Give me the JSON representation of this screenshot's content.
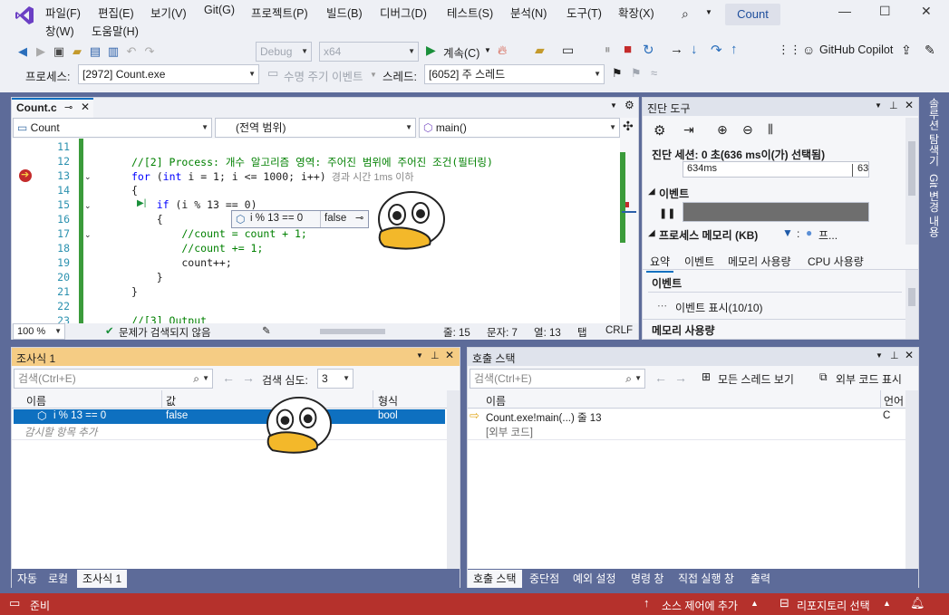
{
  "menu": {
    "items": [
      "파일(F)",
      "편집(E)",
      "보기(V)",
      "Git(G)",
      "프로젝트(P)",
      "빌드(B)",
      "디버그(D)",
      "테스트(S)",
      "분석(N)",
      "도구(T)",
      "확장(X)",
      "창(W)",
      "도움말(H)"
    ],
    "title": "Count"
  },
  "toolbar": {
    "config": "Debug",
    "platform": "x64",
    "run_label": "계속(C)",
    "copilot": "GitHub Copilot"
  },
  "debugbar": {
    "process_label": "프로세스:",
    "process_value": "[2972] Count.exe",
    "lifecycle": "수명 주기 이벤트",
    "thread_label": "스레드:",
    "thread_value": "[6052] 주 스레드"
  },
  "editor": {
    "tab": "Count.c",
    "nav_project": "Count",
    "nav_scope": "(전역 범위)",
    "nav_func": "main()",
    "lines": [
      {
        "n": "11",
        "t": ""
      },
      {
        "n": "12",
        "t": "//[2] Process: 개수 알고리즘 영역: 주어진 범위에 주어진 조건(필터링)"
      },
      {
        "n": "13",
        "t": "for (int i = 1; i <= 1000; i++)"
      },
      {
        "n": "14",
        "t": "{"
      },
      {
        "n": "15",
        "t": "    if (i % 13 == 0)"
      },
      {
        "n": "16",
        "t": "    {"
      },
      {
        "n": "17",
        "t": "        //count = count + 1;"
      },
      {
        "n": "18",
        "t": "        //count += 1;"
      },
      {
        "n": "19",
        "t": "        count++;"
      },
      {
        "n": "20",
        "t": "    }"
      },
      {
        "n": "21",
        "t": "}"
      },
      {
        "n": "22",
        "t": ""
      },
      {
        "n": "23",
        "t": "//[3] Output"
      }
    ],
    "elapsed": "경과 시간 1ms 이하",
    "datatip_expr": "i % 13 == 0",
    "datatip_val": "false",
    "zoom": "100 %",
    "issues": "문제가 검색되지 않음",
    "pos_line": "줄: 15",
    "pos_char": "문자: 7",
    "pos_col": "열: 13",
    "tab_mode": "탭",
    "eol": "CRLF"
  },
  "diag": {
    "title": "진단 도구",
    "session": "진단 세션: 0 초(636 ms이(가) 선택됨)",
    "t1": "634ms",
    "t2": "63",
    "events": "이벤트",
    "memory": "프로세스 메모리 (KB)",
    "mem_legend": "프...",
    "tabs": [
      "요약",
      "이벤트",
      "메모리 사용량",
      "CPU 사용량"
    ],
    "sec_events": "이벤트",
    "show_events": "이벤트 표시(10/10)",
    "sec_memory": "메모리 사용량"
  },
  "watch": {
    "title": "조사식 1",
    "search_ph": "검색(Ctrl+E)",
    "depth_label": "검색 심도:",
    "depth": "3",
    "cols": [
      "이름",
      "값",
      "형식"
    ],
    "row": {
      "name": "i % 13 == 0",
      "value": "false",
      "type": "bool"
    },
    "add": "감시할 항목 추가",
    "tabs": [
      "자동",
      "로컬",
      "조사식 1"
    ]
  },
  "callstack": {
    "title": "호출 스택",
    "search_ph": "검색(Ctrl+E)",
    "all_threads": "모든 스레드 보기",
    "external": "외부 코드 표시",
    "cols": [
      "이름",
      "언어"
    ],
    "rows": [
      {
        "name": "Count.exe!main(...) 줄 13",
        "lang": "C"
      },
      {
        "name": "[외부 코드]",
        "lang": ""
      }
    ],
    "tabs": [
      "호출 스택",
      "중단점",
      "예외 설정",
      "명령 창",
      "직접 실행 창",
      "출력"
    ]
  },
  "status": {
    "ready": "준비",
    "source": "소스 제어에 추가",
    "repo": "리포지토리 선택"
  },
  "side": {
    "a": "솔루션 탐색기",
    "b": "Git 변경 내용"
  },
  "colors": {
    "accent": "#5d6b99",
    "status": "#b5312c",
    "select": "#0e70c0"
  }
}
